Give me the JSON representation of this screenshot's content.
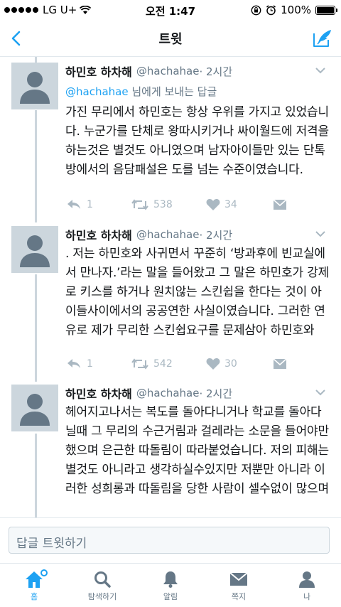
{
  "status_bar": {
    "carrier": "LG U+",
    "time": "오전 1:47",
    "battery": "100%"
  },
  "nav": {
    "title": "트윗"
  },
  "reply_prefix": "@hachahae",
  "reply_suffix": " 님에게 보내는 답글",
  "tweets": [
    {
      "name": "하민호 하차해",
      "handle": "@hachahae",
      "time": "· 2시간",
      "text": "가진 무리에서 하민호는 항상 우위를 가지고 있었습니다. 누군가를 단체로 왕따시키거나 싸이월드에 저격을 하는것은 별것도 아니였으며 남자아이들만 있는 단톡방에서의 음담패설은 도를 넘는 수준이였습니다.",
      "replies": "1",
      "retweets": "538",
      "likes": "34"
    },
    {
      "name": "하민호 하차해",
      "handle": "@hachahae",
      "time": "· 2시간",
      "text": ". 저는 하민호와 사귀면서 꾸준히 ‘방과후에 빈교실에서 만나자.’라는 말을 들어왔고 그 말은 하민호가 강제로 키스를 하거나 원치않는 스킨쉽을 한다는 것이 아이들사이에서의 공공연한 사실이였습니다. 그러한 연유로 제가 무리한 스킨쉽요구를 문제삼아 하민호와",
      "replies": "1",
      "retweets": "542",
      "likes": "30"
    },
    {
      "name": "하민호 하차해",
      "handle": "@hachahae",
      "time": "· 2시간",
      "text": "헤어지고나서는 복도를 돌아다니거나 학교를 돌아다닐때 그 무리의 수근거림과 걸레라는 소문을 들어야만 했으며 은근한 따돌림이 따라붙었습니다. 저의 피해는 별것도 아니라고 생각하실수있지만 저뿐만 아니라 이러한 성희롱과 따돌림을 당한 사람이 셀수없이 많으며"
    }
  ],
  "reply_bar": {
    "placeholder": "답글 트윗하기"
  },
  "tabs": [
    {
      "label": "홈",
      "icon": "home-icon",
      "active": true
    },
    {
      "label": "탐색하기",
      "icon": "search-icon"
    },
    {
      "label": "알림",
      "icon": "bell-icon"
    },
    {
      "label": "쪽지",
      "icon": "envelope-icon"
    },
    {
      "label": "나",
      "icon": "person-icon"
    }
  ],
  "colors": {
    "accent": "#1da1f2",
    "muted": "#657786",
    "icon_gray": "#aab8c2",
    "avatar_bg": "#ccd6dd"
  }
}
